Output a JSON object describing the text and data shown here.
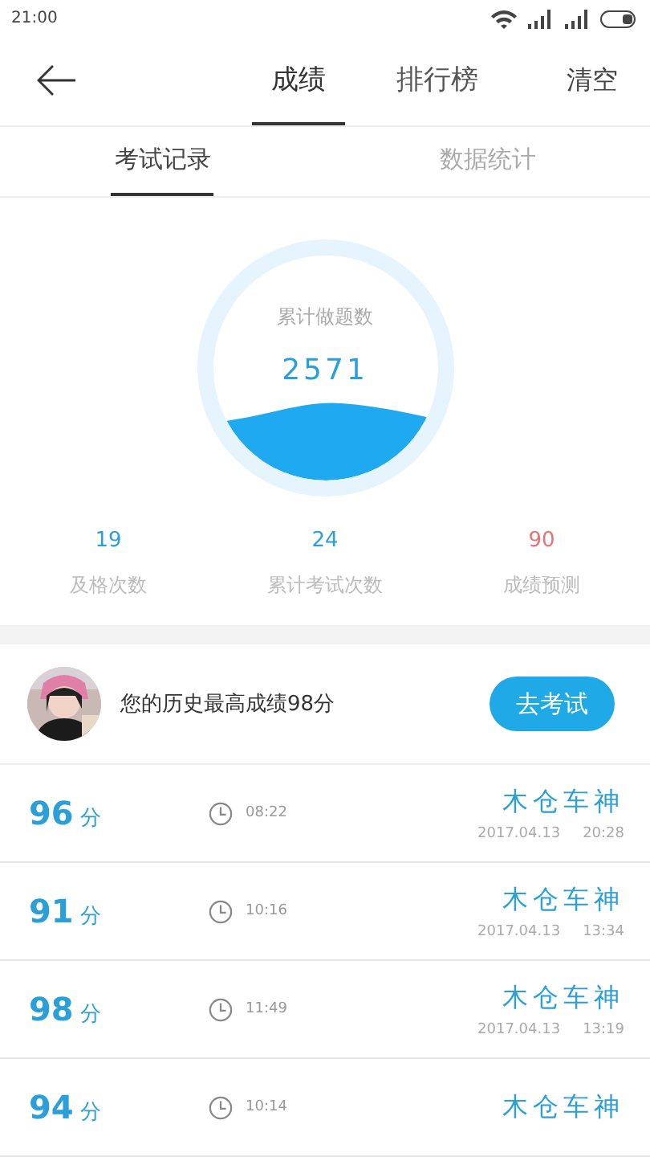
{
  "status_bar": {
    "time": "21:00"
  },
  "header": {
    "tabs": [
      {
        "label": "成绩",
        "selected": true
      },
      {
        "label": "排行榜",
        "selected": false
      }
    ],
    "action": "清空"
  },
  "sub_tabs": [
    {
      "label": "考试记录",
      "selected": true
    },
    {
      "label": "数据统计",
      "selected": false
    }
  ],
  "gauge": {
    "label": "累计做题数",
    "value": "2571"
  },
  "stats": [
    {
      "value": "19",
      "label": "及格次数",
      "color": "#2a9fd8"
    },
    {
      "value": "24",
      "label": "累计考试次数",
      "color": "#2a9fd8"
    },
    {
      "value": "90",
      "label": "成绩预测",
      "color": "#e57373"
    }
  ],
  "best": {
    "text": "您的历史最高成绩98分",
    "button": "去考试"
  },
  "records": [
    {
      "score": "96",
      "unit": "分",
      "duration": "08:22",
      "name": "木仓车神",
      "date": "2017.04.13",
      "time": "20:28"
    },
    {
      "score": "91",
      "unit": "分",
      "duration": "10:16",
      "name": "木仓车神",
      "date": "2017.04.13",
      "time": "13:34"
    },
    {
      "score": "98",
      "unit": "分",
      "duration": "11:49",
      "name": "木仓车神",
      "date": "2017.04.13",
      "time": "13:19"
    },
    {
      "score": "94",
      "unit": "分",
      "duration": "10:14",
      "name": "木仓车神"
    }
  ]
}
